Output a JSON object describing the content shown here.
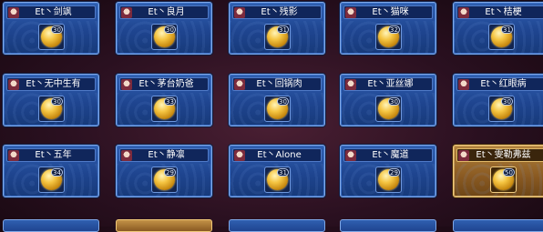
{
  "cards": [
    {
      "name": "Et丶剑飒",
      "level": "30",
      "variant": "blue"
    },
    {
      "name": "Et丶良月",
      "level": "30",
      "variant": "blue"
    },
    {
      "name": "Et丶残影",
      "level": "31",
      "variant": "blue"
    },
    {
      "name": "Et丶猫咪",
      "level": "32",
      "variant": "blue"
    },
    {
      "name": "Et丶桔梗",
      "level": "31",
      "variant": "blue"
    },
    {
      "name": "Et丶无中生有",
      "level": "30",
      "variant": "blue"
    },
    {
      "name": "Et丶茅台奶爸",
      "level": "33",
      "variant": "blue"
    },
    {
      "name": "Et丶回锅肉",
      "level": "30",
      "variant": "blue"
    },
    {
      "name": "Et丶亚丝娜",
      "level": "30",
      "variant": "blue"
    },
    {
      "name": "Et丶红眼病",
      "level": "30",
      "variant": "blue"
    },
    {
      "name": "Et丶五年",
      "level": "34",
      "variant": "blue"
    },
    {
      "name": "Et丶静凛",
      "level": "29",
      "variant": "blue"
    },
    {
      "name": "Et丶Alone",
      "level": "31",
      "variant": "blue"
    },
    {
      "name": "Et丶魔道",
      "level": "29",
      "variant": "blue"
    },
    {
      "name": "Et丶雯勒弗兹",
      "level": "50",
      "variant": "gold"
    }
  ],
  "bottom_row_partial": [
    "blue",
    "gold",
    "blue",
    "blue",
    "blue"
  ]
}
